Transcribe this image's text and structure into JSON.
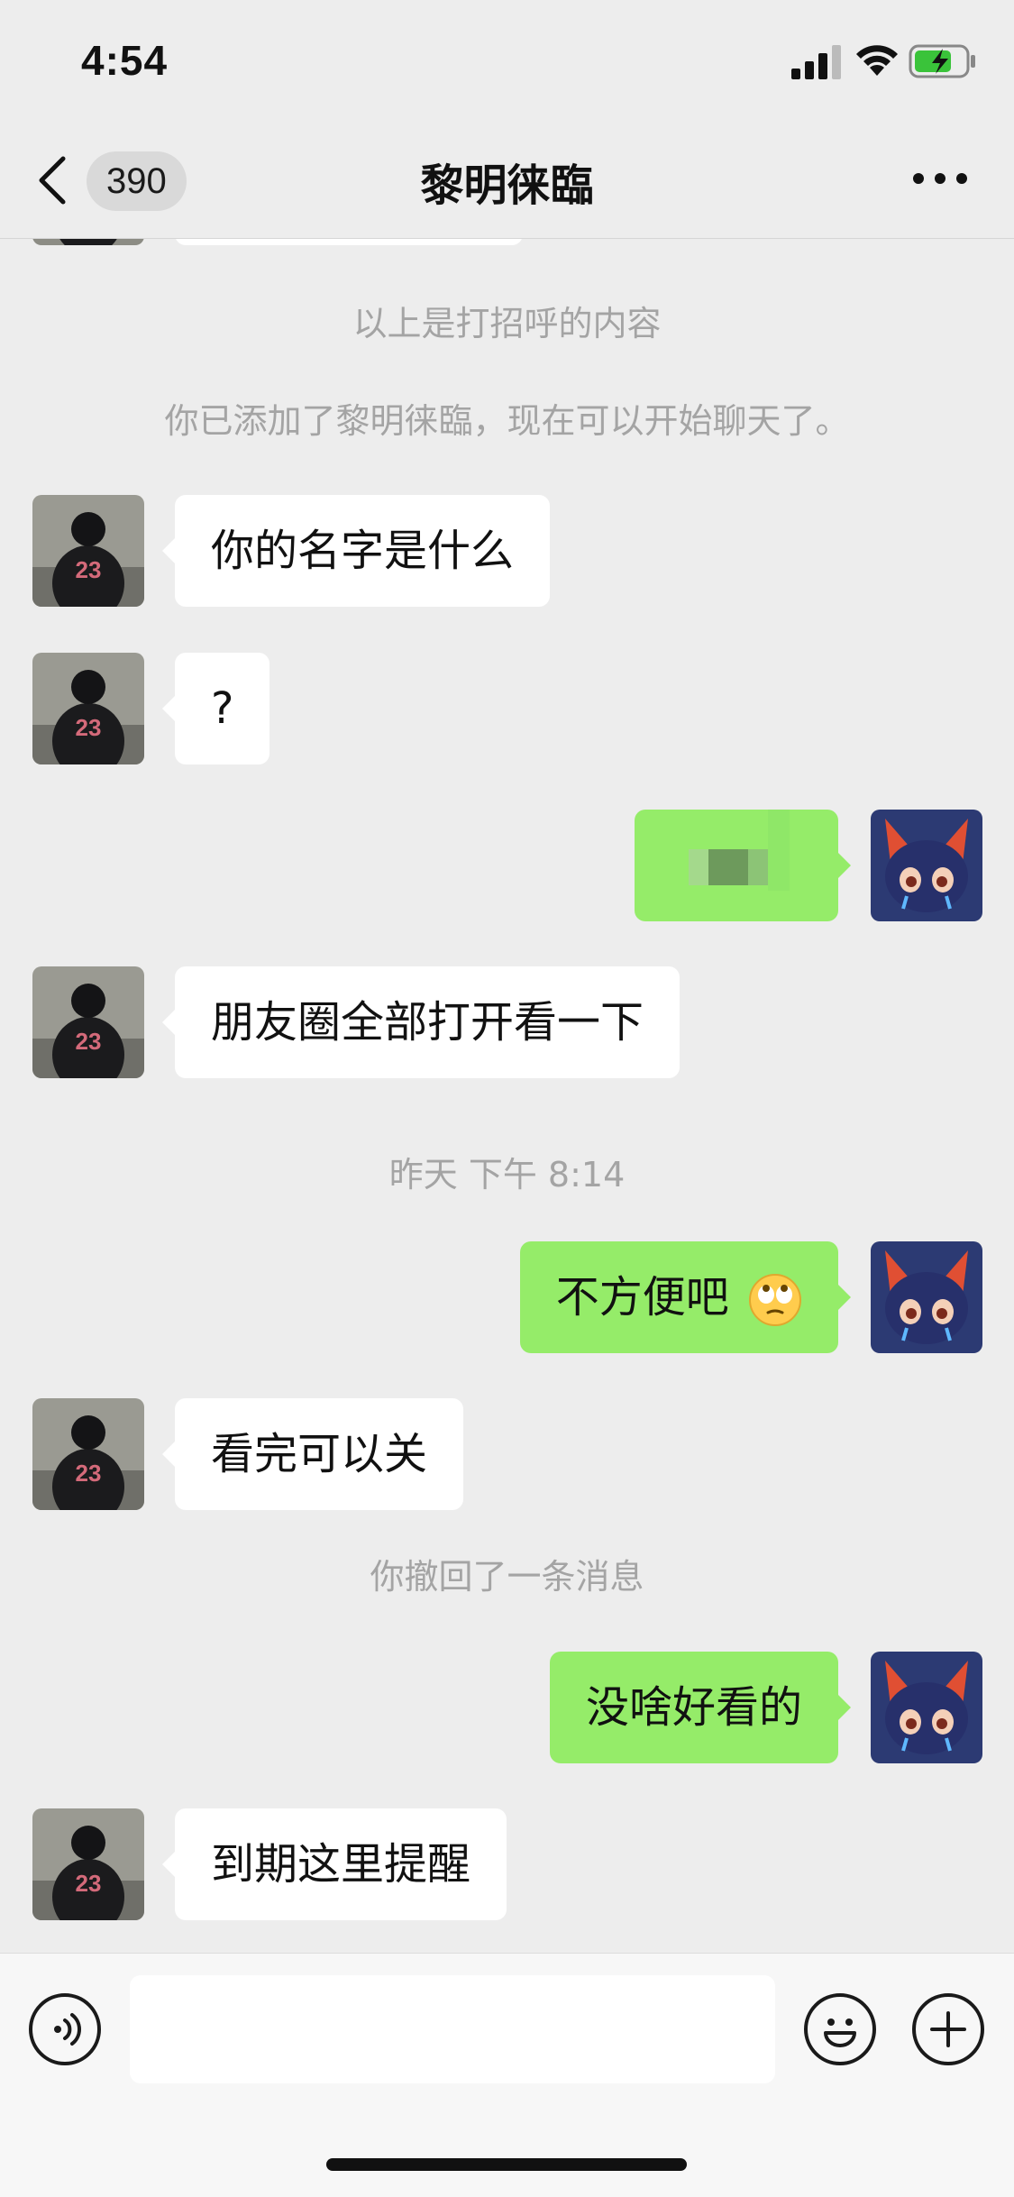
{
  "status_bar": {
    "time": "4:54"
  },
  "nav": {
    "back_count": "390",
    "title": "黎明徕臨"
  },
  "messages": {
    "sys_greeting": "以上是打招呼的内容",
    "sys_added": "你已添加了黎明徕臨，现在可以开始聊天了。",
    "m1": "你的名字是什么",
    "m2": "?",
    "m4": "朋友圈全部打开看一下",
    "sys_time": "昨天 下午 8:14",
    "m5": "不方便吧",
    "m6": "看完可以关",
    "sys_recall": "你撤回了一条消息",
    "m7": "没啥好看的",
    "m8": "到期这里提醒"
  },
  "colors": {
    "outgoing_bubble": "#95ec69",
    "incoming_bubble": "#ffffff",
    "background": "#ededed"
  },
  "icons": [
    "back-chevron-icon",
    "more-icon",
    "voice-icon",
    "emoji-icon",
    "plus-icon"
  ]
}
